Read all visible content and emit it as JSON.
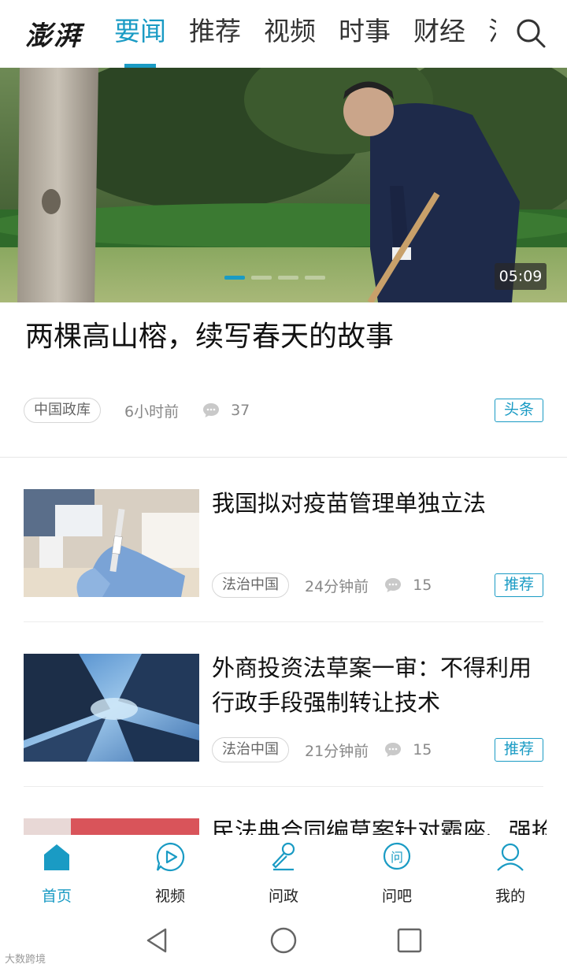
{
  "header": {
    "logo": "澎湃",
    "tabs": [
      {
        "label": "要闻",
        "active": true
      },
      {
        "label": "推荐",
        "active": false
      },
      {
        "label": "视频",
        "active": false
      },
      {
        "label": "时事",
        "active": false
      },
      {
        "label": "财经",
        "active": false
      },
      {
        "label": "法",
        "active": false
      }
    ],
    "search_icon": "search-icon",
    "accent_color": "#1a9bc4"
  },
  "hero": {
    "image": "photo: man shoveling soil beside tree trunk in park",
    "duration": "05:09",
    "carousel_active_index": 0,
    "carousel_count": 4,
    "title": "两棵高山榕，续写春天的故事",
    "source": "中国政库",
    "time": "6小时前",
    "comments": "37",
    "badge": "头条"
  },
  "articles": [
    {
      "title": "我国拟对疫苗管理单独立法",
      "image": "photo: gloved hands holding a vaccine syringe",
      "source": "法治中国",
      "time": "24分钟前",
      "comments": "15",
      "badge": "推荐"
    },
    {
      "title": "外商投资法草案一审：不得利用行政手段强制转让技术",
      "image": "photo: skyscrapers viewed from below against blue sky",
      "source": "法治中国",
      "time": "21分钟前",
      "comments": "15",
      "badge": "推荐"
    },
    {
      "title": "民法典合同编草案针对霸座、强抢",
      "image": "photo: red object, partially hidden"
    }
  ],
  "bottom_nav": [
    {
      "label": "首页",
      "icon": "home-icon",
      "active": true
    },
    {
      "label": "视频",
      "icon": "video-play-icon",
      "active": false
    },
    {
      "label": "问政",
      "icon": "microphone-icon",
      "active": false
    },
    {
      "label": "问吧",
      "icon": "ask-bubble-icon",
      "active": false
    },
    {
      "label": "我的",
      "icon": "user-icon",
      "active": false
    }
  ],
  "system_nav": [
    "back-icon",
    "home-circle-icon",
    "recents-icon"
  ],
  "watermark": "大数跨境"
}
